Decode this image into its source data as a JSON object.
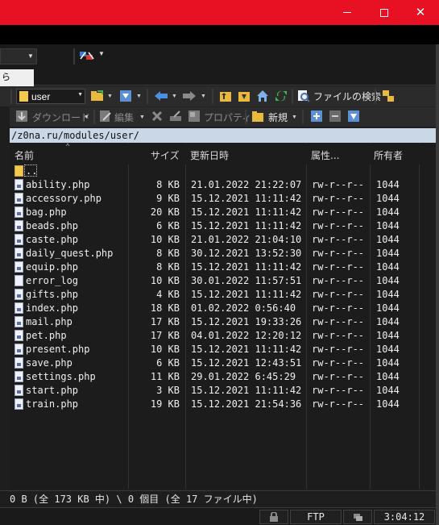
{
  "window": {
    "minimize_glyph": "",
    "maximize_glyph": "",
    "close_glyph": "✕"
  },
  "tab": {
    "label": "ら"
  },
  "toolbar1": {
    "folder_combo_value": "user",
    "file_search_label": "ファイルの検索"
  },
  "toolbar2": {
    "download_label": "ダウンロード",
    "edit_label": "編集",
    "properties_label": "プロパティ",
    "new_label": "新規"
  },
  "path": "/z0na.ru/modules/user/",
  "columns": {
    "name": "名前",
    "size": "サイズ",
    "modified": "更新日時",
    "attributes": "属性...",
    "owner": "所有者"
  },
  "parent_entry": "..",
  "files": [
    {
      "name": "ability.php",
      "size": "8 KB",
      "date": "21.01.2022 21:22:07",
      "attr": "rw-r--r--",
      "owner": "1044",
      "type": "php"
    },
    {
      "name": "accessory.php",
      "size": "9 KB",
      "date": "15.12.2021 11:11:42",
      "attr": "rw-r--r--",
      "owner": "1044",
      "type": "php"
    },
    {
      "name": "bag.php",
      "size": "20 KB",
      "date": "15.12.2021 11:11:42",
      "attr": "rw-r--r--",
      "owner": "1044",
      "type": "php"
    },
    {
      "name": "beads.php",
      "size": "6 KB",
      "date": "15.12.2021 11:11:42",
      "attr": "rw-r--r--",
      "owner": "1044",
      "type": "php"
    },
    {
      "name": "caste.php",
      "size": "10 KB",
      "date": "21.01.2022 21:04:10",
      "attr": "rw-r--r--",
      "owner": "1044",
      "type": "php"
    },
    {
      "name": "daily_quest.php",
      "size": "8 KB",
      "date": "30.12.2021 13:52:30",
      "attr": "rw-r--r--",
      "owner": "1044",
      "type": "php"
    },
    {
      "name": "equip.php",
      "size": "8 KB",
      "date": "15.12.2021 11:11:42",
      "attr": "rw-r--r--",
      "owner": "1044",
      "type": "php"
    },
    {
      "name": "error_log",
      "size": "10 KB",
      "date": "30.01.2022 11:57:51",
      "attr": "rw-r--r--",
      "owner": "1044",
      "type": "plain"
    },
    {
      "name": "gifts.php",
      "size": "4 KB",
      "date": "15.12.2021 11:11:42",
      "attr": "rw-r--r--",
      "owner": "1044",
      "type": "php"
    },
    {
      "name": "index.php",
      "size": "18 KB",
      "date": "01.02.2022 0:56:40",
      "attr": "rw-r--r--",
      "owner": "1044",
      "type": "php"
    },
    {
      "name": "mail.php",
      "size": "17 KB",
      "date": "15.12.2021 19:33:26",
      "attr": "rw-r--r--",
      "owner": "1044",
      "type": "php"
    },
    {
      "name": "pet.php",
      "size": "17 KB",
      "date": "04.01.2022 12:20:12",
      "attr": "rw-r--r--",
      "owner": "1044",
      "type": "php"
    },
    {
      "name": "present.php",
      "size": "10 KB",
      "date": "15.12.2021 11:11:42",
      "attr": "rw-r--r--",
      "owner": "1044",
      "type": "php"
    },
    {
      "name": "save.php",
      "size": "6 KB",
      "date": "15.12.2021 12:43:51",
      "attr": "rw-r--r--",
      "owner": "1044",
      "type": "php"
    },
    {
      "name": "settings.php",
      "size": "11 KB",
      "date": "29.01.2022 6:45:29",
      "attr": "rw-r--r--",
      "owner": "1044",
      "type": "php"
    },
    {
      "name": "start.php",
      "size": "3 KB",
      "date": "15.12.2021 11:11:42",
      "attr": "rw-r--r--",
      "owner": "1044",
      "type": "php"
    },
    {
      "name": "train.php",
      "size": "19 KB",
      "date": "15.12.2021 21:54:36",
      "attr": "rw-r--r--",
      "owner": "1044",
      "type": "php"
    }
  ],
  "status": {
    "summary": "0 B (全 173 KB 中) \\ 0 個目 (全 17 ファイル中)",
    "protocol": "FTP",
    "clock": "3:04:12"
  },
  "colors": {
    "titlebar": "#e81123",
    "path_bar": "#c9d7e6",
    "background": "#1c1c1c"
  }
}
